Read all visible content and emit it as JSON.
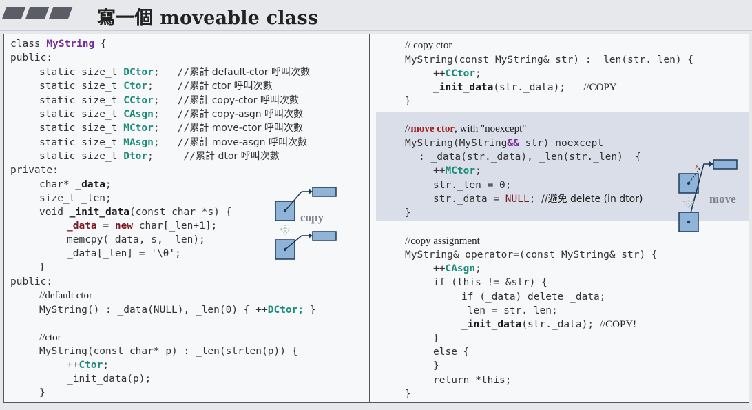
{
  "header": {
    "title": "寫一個 moveable class",
    "accent_color": "#5a5d66"
  },
  "left": {
    "l1": [
      "class ",
      "MyString",
      " {"
    ],
    "l2": "public:",
    "static_prefix": "static size_t ",
    "statics": [
      {
        "name": "DCtor",
        "pad": ";   ",
        "comment_prefix": "//",
        "comment": "累計 default-ctor 呼叫次數"
      },
      {
        "name": "Ctor",
        "pad": ";    ",
        "comment_prefix": "//",
        "comment": "累計 ctor 呼叫次數"
      },
      {
        "name": "CCtor",
        "pad": ";   ",
        "comment_prefix": "//",
        "comment": "累計 copy-ctor 呼叫次數"
      },
      {
        "name": "CAsgn",
        "pad": ";   ",
        "comment_prefix": "//",
        "comment": "累計 copy-asgn 呼叫次數"
      },
      {
        "name": "MCtor",
        "pad": ";   ",
        "comment_prefix": "//",
        "comment": "累計 move-ctor 呼叫次數"
      },
      {
        "name": "MAsgn",
        "pad": ";   ",
        "comment_prefix": "//",
        "comment": "累計 move-asgn 呼叫次數"
      },
      {
        "name": "Dtor",
        "pad": ";     ",
        "comment_prefix": "//",
        "comment": "累計 dtor 呼叫次數"
      }
    ],
    "private": "private:",
    "data_decl": [
      "char* ",
      "_data",
      ";"
    ],
    "len_decl": "size_t _len;",
    "init_sig": [
      "void ",
      "_init_data",
      "(const char *s) {"
    ],
    "init_l1": [
      "_data",
      " = ",
      "new",
      " char[_len+1];"
    ],
    "init_l2": "memcpy(_data, s, _len);",
    "init_l3": "_data[_len] = '\\0';",
    "close1": "}",
    "public2": "public:",
    "default_ctor_comment": "//default ctor",
    "default_ctor": [
      "MyString() : _data(NULL), _len(0) { ++",
      "DCtor;",
      " }"
    ],
    "ctor_comment": "//ctor",
    "ctor_sig": "MyString(const char* p) : _len(strlen(p)) {",
    "ctor_l1": [
      "++",
      "Ctor",
      ";"
    ],
    "ctor_l2": "_init_data(p);",
    "ctor_close": "}",
    "diagram_label": "copy"
  },
  "right": {
    "copy_comment": "// copy ctor",
    "copy_sig": "MyString(const MyString& str) : _len(str._len) {",
    "copy_l1": [
      "++",
      "CCtor",
      ";"
    ],
    "copy_l2": [
      "_init_data",
      "(str._data);   ",
      "//COPY"
    ],
    "copy_close": "}",
    "move_comment": [
      "//",
      "move ctor",
      ", with \"noexcept\""
    ],
    "move_sig": [
      "MyString(MyString",
      "&&",
      " str) noexcept"
    ],
    "move_init": ": _data(str._data), _len(str._len)  {",
    "move_l1": [
      "++",
      "MCtor",
      ";"
    ],
    "move_l2": "str._len = 0;",
    "move_l3": [
      "str._data = ",
      "NULL",
      "; ",
      "//避免 delete (in dtor)"
    ],
    "move_close": "}",
    "asgn_comment": "//copy assignment",
    "asgn_sig": "MyString& operator=(const MyString& str) {",
    "asgn_l1": [
      "++",
      "CAsgn",
      ";"
    ],
    "asgn_l2": "if (this != &str) {",
    "asgn_l3": "if (_data) delete _data;",
    "asgn_l4": "_len = str._len;",
    "asgn_l5": [
      "_init_data",
      "(str._data); ",
      "//COPY!"
    ],
    "asgn_close1": "}",
    "asgn_else": "else {",
    "asgn_close2": "}",
    "asgn_ret": "return *this;",
    "asgn_close3": "}",
    "diagram_label": "move"
  }
}
